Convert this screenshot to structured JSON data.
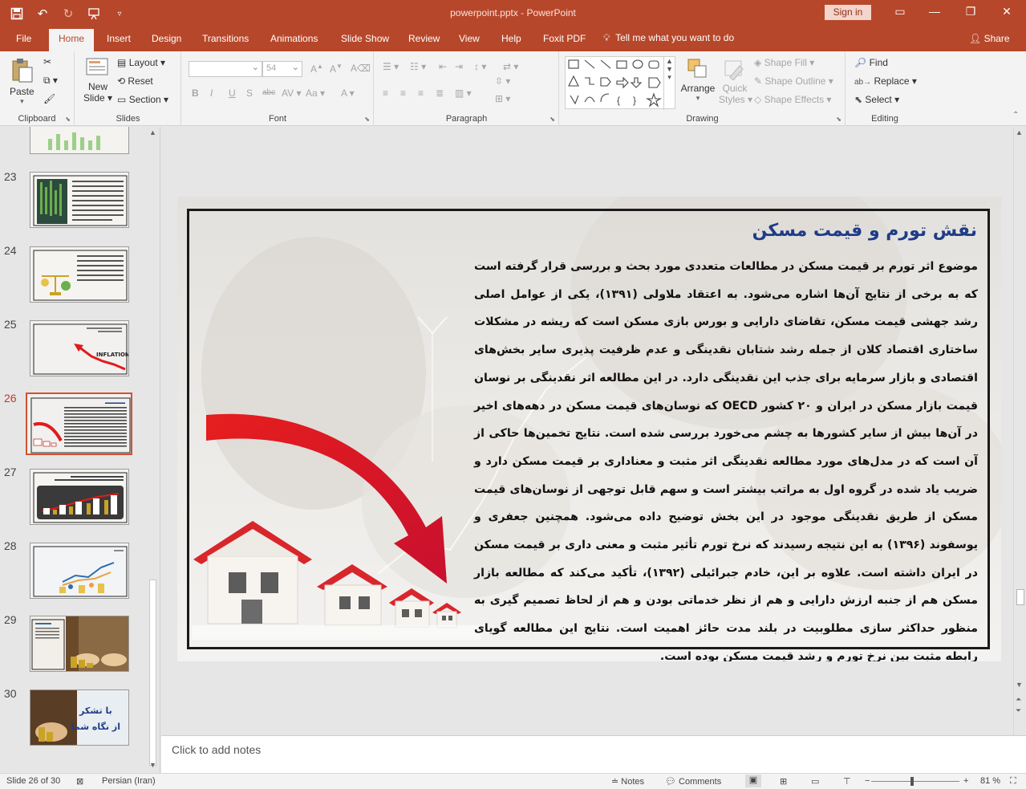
{
  "window": {
    "title": "powerpoint.pptx  -  PowerPoint",
    "signin": "Sign in"
  },
  "tabs": [
    "File",
    "Home",
    "Insert",
    "Design",
    "Transitions",
    "Animations",
    "Slide Show",
    "Review",
    "View",
    "Help",
    "Foxit PDF"
  ],
  "active_tab": "Home",
  "tellme": "Tell me what you want to do",
  "share": "Share",
  "ribbon": {
    "clipboard": {
      "name": "Clipboard",
      "paste": "Paste"
    },
    "slides": {
      "name": "Slides",
      "new_slide_1": "New",
      "new_slide_2": "Slide",
      "layout": "Layout",
      "reset": "Reset",
      "section": "Section"
    },
    "font": {
      "name": "Font",
      "font_size": "54"
    },
    "paragraph": {
      "name": "Paragraph"
    },
    "drawing": {
      "name": "Drawing",
      "arrange": "Arrange",
      "quick_styles_1": "Quick",
      "quick_styles_2": "Styles",
      "shape_fill": "Shape Fill",
      "shape_outline": "Shape Outline",
      "shape_effects": "Shape Effects"
    },
    "editing": {
      "name": "Editing",
      "find": "Find",
      "replace": "Replace",
      "select": "Select"
    }
  },
  "thumbnails": [
    {
      "num": "23",
      "active": false
    },
    {
      "num": "24",
      "active": false
    },
    {
      "num": "25",
      "active": false
    },
    {
      "num": "26",
      "active": true
    },
    {
      "num": "27",
      "active": false
    },
    {
      "num": "28",
      "active": false
    },
    {
      "num": "29",
      "active": false
    },
    {
      "num": "30",
      "active": false
    }
  ],
  "thumb30_text": {
    "line1": "با تشکر",
    "line2": "از نگاه شما"
  },
  "slide": {
    "title": "نقش تورم و قیمت مسکن",
    "body": "موضوع اثر تورم بر قیمت مسکن در مطالعات متعددی مورد بحث و بررسی قرار گرفته است که به برخی از نتایج آن‌ها اشاره می‌شود. به اعتقاد ملاولی (۱۳۹۱)، یکی از عوامل اصلی رشد جهشی قیمت مسکن، تقاضای دارایی و بورس بازی مسکن است که ریشه در مشکلات ساختاری اقتصاد کلان از جمله رشد شتابان نقدینگی و عدم ظرفیت پذیری سایر بخش‌های اقتصادی و بازار سرمایه برای جذب این نقدینگی دارد. در این مطالعه اثر نقدینگی بر نوسان قیمت بازار مسکن در ایران و ۲۰ کشور  OECD که نوسان‌های قیمت مسکن در دهه‌های اخیر در آن‌ها بیش از سایر کشورها به چشم می‌خورد بررسی شده است. نتایج تخمین‌ها حاکی از آن است که در مدل‌های مورد مطالعه نقدینگی اثر مثبت و معناداری بر قیمت مسکن دارد و ضریب یاد شده در گروه اول به مراتب بیشتر است و سهم قابل توجهی از نوسان‌های قیمت مسکن از طریق نقدینگی موجود در این بخش توضیح داده می‌شود. همچنین جعفری و یوسفوند (۱۳۹۶) به این نتیجه رسیدند که نرخ تورم تأثیر مثبت و معنی داری بر قیمت مسکن در ایران داشته است. علاوه بر این، خادم جبرائیلی (۱۳۹۲)، تأکید می‌کند که مطالعه بازار مسکن هم از جنبه ارزش دارایی و هم از نظر خدماتی بودن و هم از لحاظ تصمیم گیری به منظور حداکثر سازی مطلوبیت در بلند مدت حائز اهمیت است. نتایج این مطالعه گویای رابطه مثبت بین نرخ تورم و رشد قیمت مسکن بوده است."
  },
  "notes_placeholder": "Click to add notes",
  "status": {
    "slide_info": "Slide 26 of 30",
    "language": "Persian (Iran)",
    "notes": "Notes",
    "comments": "Comments",
    "zoom": "81 %"
  },
  "colors": {
    "accent": "#b7472a",
    "title_blue": "#1f3c88",
    "arrow_red": "#e21b1b"
  }
}
